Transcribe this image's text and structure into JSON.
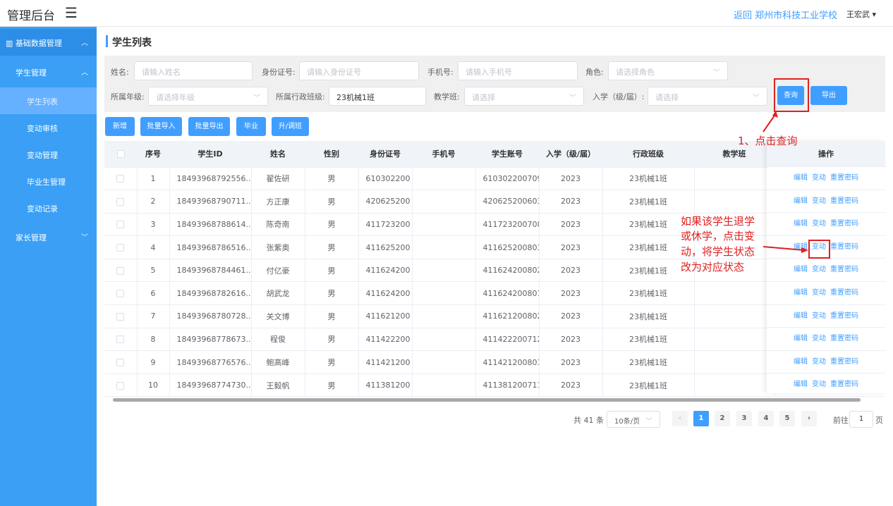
{
  "header": {
    "app_title": "管理后台",
    "menu_icon": "hamburger-icon",
    "back_link": "返回 郑州市科技工业学校",
    "user_name": "王宏武"
  },
  "sidebar": {
    "items": [
      {
        "label": "基础数据管理",
        "chev": "^"
      },
      {
        "label": "学生管理",
        "chev": "^"
      },
      {
        "label": "学生列表"
      },
      {
        "label": "变动审核"
      },
      {
        "label": "变动管理"
      },
      {
        "label": "毕业生管理"
      },
      {
        "label": "变动记录"
      },
      {
        "label": "家长管理",
        "chev": "v"
      }
    ]
  },
  "page": {
    "title": "学生列表"
  },
  "filters": {
    "name_label": "姓名:",
    "name_placeholder": "请输入姓名",
    "id_label": "身份证号:",
    "id_placeholder": "请输入身份证号",
    "phone_label": "手机号:",
    "phone_placeholder": "请输入手机号",
    "role_label": "角色:",
    "role_placeholder": "请选择角色",
    "grade_label": "所属年级:",
    "grade_placeholder": "请选择年级",
    "class_label": "所属行政班级:",
    "class_value": "23机械1班",
    "teach_label": "教学班:",
    "teach_placeholder": "请选择",
    "enroll_label": "入学（级/届）:",
    "enroll_placeholder": "请选择",
    "query_button": "查询",
    "export_button": "导出"
  },
  "toolbar": {
    "add": "新增",
    "batch_import": "批量导入",
    "batch_export": "批量导出",
    "graduate": "毕业",
    "promote": "升/调班"
  },
  "annotations": {
    "step1": "1、点击查询",
    "note_lines": [
      "如果该学生退学",
      "或休学，点击变",
      "动，将学生状态",
      "改为对应状态"
    ]
  },
  "table": {
    "columns": [
      "序号",
      "学生ID",
      "姓名",
      "性别",
      "身份证号",
      "手机号",
      "学生账号",
      "入学（级/届）",
      "行政班级",
      "教学班",
      "操作"
    ],
    "rows": [
      {
        "no": "1",
        "sid": "18493968792556...",
        "name": "翟佐研",
        "gender": "男",
        "idcard": "610302200",
        "phone": "",
        "account": "610302200709",
        "enroll": "2023",
        "cls": "23机械1班",
        "teach": ""
      },
      {
        "no": "2",
        "sid": "18493968790711...",
        "name": "方正康",
        "gender": "男",
        "idcard": "420625200",
        "phone": "",
        "account": "420625200603",
        "enroll": "2023",
        "cls": "23机械1班",
        "teach": ""
      },
      {
        "no": "3",
        "sid": "18493968788614...",
        "name": "陈奇南",
        "gender": "男",
        "idcard": "411723200",
        "phone": "",
        "account": "411723200708",
        "enroll": "2023",
        "cls": "23机械1班",
        "teach": ""
      },
      {
        "no": "4",
        "sid": "18493968786516...",
        "name": "张紫奥",
        "gender": "男",
        "idcard": "411625200",
        "phone": "",
        "account": "411625200803",
        "enroll": "2023",
        "cls": "23机械1班",
        "teach": ""
      },
      {
        "no": "5",
        "sid": "18493968784461...",
        "name": "付亿豪",
        "gender": "男",
        "idcard": "411624200",
        "phone": "",
        "account": "411624200802",
        "enroll": "2023",
        "cls": "23机械1班",
        "teach": ""
      },
      {
        "no": "6",
        "sid": "18493968782616...",
        "name": "胡武龙",
        "gender": "男",
        "idcard": "411624200",
        "phone": "",
        "account": "411624200801",
        "enroll": "2023",
        "cls": "23机械1班",
        "teach": ""
      },
      {
        "no": "7",
        "sid": "18493968780728...",
        "name": "关文博",
        "gender": "男",
        "idcard": "411621200",
        "phone": "",
        "account": "411621200802",
        "enroll": "2023",
        "cls": "23机械1班",
        "teach": ""
      },
      {
        "no": "8",
        "sid": "18493968778673...",
        "name": "程俊",
        "gender": "男",
        "idcard": "411422200",
        "phone": "",
        "account": "411422200712",
        "enroll": "2023",
        "cls": "23机械1班",
        "teach": ""
      },
      {
        "no": "9",
        "sid": "18493968776576...",
        "name": "鲍高峰",
        "gender": "男",
        "idcard": "411421200",
        "phone": "",
        "account": "411421200803",
        "enroll": "2023",
        "cls": "23机械1班",
        "teach": ""
      },
      {
        "no": "10",
        "sid": "18493968774730...",
        "name": "王毅帆",
        "gender": "男",
        "idcard": "411381200",
        "phone": "",
        "account": "411381200711",
        "enroll": "2023",
        "cls": "23机械1班",
        "teach": ""
      }
    ],
    "ops": {
      "edit": "编辑",
      "change": "变动",
      "reset": "重置密码"
    }
  },
  "pagination": {
    "total": "共 41 条",
    "page_size": "10条/页",
    "pages": [
      "1",
      "2",
      "3",
      "4",
      "5"
    ],
    "current": "1",
    "goto_label": "前往",
    "goto_value": "1",
    "page_suffix": "页"
  },
  "colors": {
    "primary": "#409eff",
    "sidebar": "#3a9ff5",
    "annotation": "#e02020"
  }
}
